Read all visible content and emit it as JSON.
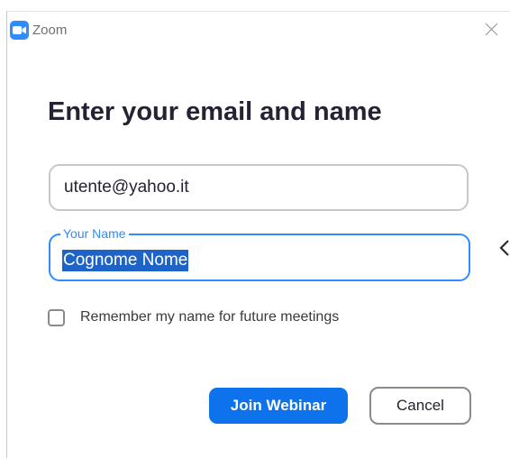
{
  "window": {
    "title": "Zoom",
    "app_icon": "zoom-camera-icon",
    "close_icon": "close-icon"
  },
  "dialog": {
    "heading": "Enter your email and name",
    "email": {
      "value": "utente@yahoo.it"
    },
    "name": {
      "label": "Your Name",
      "value": "Cognome Nome"
    },
    "remember": {
      "label": "Remember my name for future meetings",
      "checked": false
    },
    "buttons": {
      "join_label": "Join Webinar",
      "cancel_label": "Cancel"
    }
  },
  "colors": {
    "accent": "#0e72ed",
    "focus_border": "#2d8cff",
    "selection": "#1e64c8",
    "heading_text": "#232333"
  }
}
